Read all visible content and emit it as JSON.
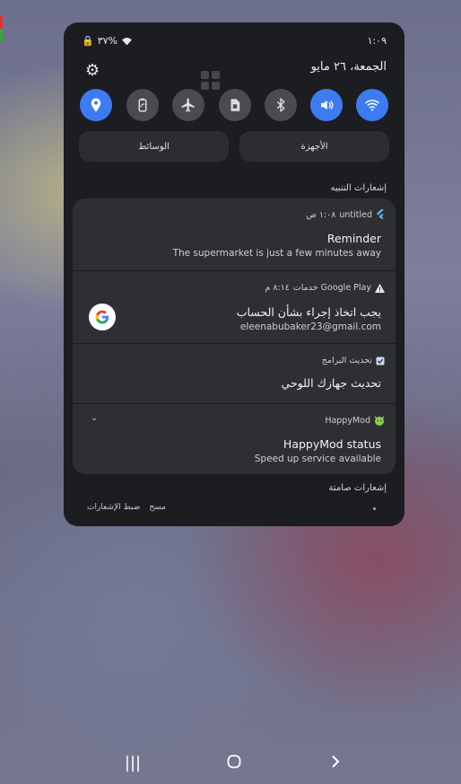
{
  "status_bar": {
    "battery": "٣٧%",
    "time": "١:٠٩"
  },
  "header": {
    "date": "الجمعة، ٢٦ مايو",
    "settings_icon": "gear-icon"
  },
  "quick_toggles": [
    {
      "name": "wifi",
      "on": true
    },
    {
      "name": "sound",
      "on": true
    },
    {
      "name": "bluetooth",
      "on": false
    },
    {
      "name": "sim",
      "on": false
    },
    {
      "name": "airplane",
      "on": false
    },
    {
      "name": "power-saving",
      "on": false
    },
    {
      "name": "location",
      "on": true
    }
  ],
  "media_row": {
    "devices": "الأجهزة",
    "media": "الوسائط"
  },
  "alerts_label": "إشعارات التنبيه",
  "notifications": [
    {
      "app": "untitled",
      "time": "١:٠٨ ص",
      "title": "Reminder",
      "body": "The supermarket is just a few minutes away"
    },
    {
      "app": "خدمات Google Play",
      "time": "٨:١٤ م",
      "title": "يجب اتخاذ إجراء بشأن الحساب",
      "body": "eleenabubaker23@gmail.com"
    },
    {
      "app": "تحديث البرامج",
      "title": "تحديث جهازك اللوحي"
    },
    {
      "app": "HappyMod",
      "title": "HappyMod status",
      "body": "Speed up service available"
    }
  ],
  "silent_label": "إشعارات صامتة",
  "actions": {
    "settings": "ضبط الإشعارات",
    "clear": "مسح"
  },
  "accent": "#3d7bf0"
}
